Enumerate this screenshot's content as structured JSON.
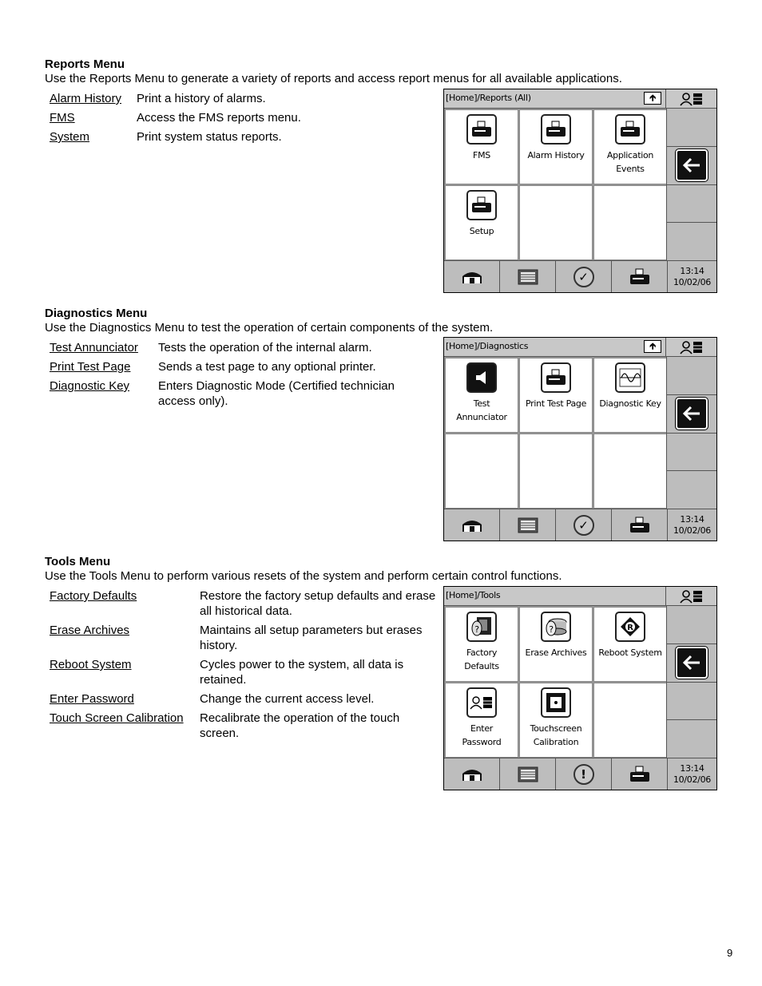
{
  "page_number": "9",
  "sections": [
    {
      "title": "Reports Menu",
      "intro": "Use the Reports Menu to generate a variety of reports and access report menus for all available applications.",
      "items": [
        {
          "term": "Alarm History",
          "desc": "Print a history of alarms."
        },
        {
          "term": "FMS",
          "desc": "Access the FMS reports menu."
        },
        {
          "term": "System",
          "desc": "Print system status reports."
        }
      ],
      "screen": {
        "breadcrumb": "[Home]/Reports (All)",
        "has_up_button": true,
        "tiles": [
          {
            "label": "FMS",
            "icon": "printer-icon"
          },
          {
            "label": "Alarm History",
            "icon": "printer-icon"
          },
          {
            "label": "Application Events",
            "icon": "printer-icon"
          },
          {
            "label": "Setup",
            "icon": "printer-icon"
          },
          {
            "label": "",
            "icon": ""
          },
          {
            "label": "",
            "icon": ""
          }
        ],
        "status_icon": "check-icon",
        "time": "13:14",
        "date": "10/02/06"
      }
    },
    {
      "title": "Diagnostics Menu",
      "intro": "Use the Diagnostics Menu to test the operation of certain components of the system.",
      "items": [
        {
          "term": "Test Annunciator",
          "desc": "Tests the operation of the internal alarm."
        },
        {
          "term": "Print Test Page",
          "desc": "Sends a test page to any optional printer."
        },
        {
          "term": "Diagnostic Key",
          "desc": "Enters Diagnostic Mode (Certified technician access only)."
        }
      ],
      "screen": {
        "breadcrumb": "[Home]/Diagnostics",
        "has_up_button": true,
        "tiles": [
          {
            "label": "Test Annunciator",
            "icon": "speaker-icon"
          },
          {
            "label": "Print Test Page",
            "icon": "printer-icon"
          },
          {
            "label": "Diagnostic Key",
            "icon": "waveform-icon"
          },
          {
            "label": "",
            "icon": ""
          },
          {
            "label": "",
            "icon": ""
          },
          {
            "label": "",
            "icon": ""
          }
        ],
        "status_icon": "check-icon",
        "time": "13:14",
        "date": "10/02/06"
      }
    },
    {
      "title": "Tools Menu",
      "intro": "Use the Tools Menu to perform various resets of the system and perform certain control functions.",
      "items": [
        {
          "term": "Factory Defaults",
          "desc": "Restore the factory setup defaults and erase all historical data."
        },
        {
          "term": "Erase Archives",
          "desc": "Maintains all setup parameters but erases history."
        },
        {
          "term": "Reboot System",
          "desc": "Cycles power to the system, all data is retained."
        },
        {
          "term": "Enter Password",
          "desc": "Change the current access level."
        },
        {
          "term": "Touch Screen Calibration",
          "desc": "Recalibrate the operation of the touch screen."
        }
      ],
      "screen": {
        "breadcrumb": "[Home]/Tools",
        "has_up_button": false,
        "tiles": [
          {
            "label": "Factory Defaults",
            "icon": "factory-defaults-icon"
          },
          {
            "label": "Erase Archives",
            "icon": "erase-archives-icon"
          },
          {
            "label": "Reboot System",
            "icon": "reboot-icon"
          },
          {
            "label": "Enter Password",
            "icon": "password-icon"
          },
          {
            "label": "Touchscreen Calibration",
            "icon": "calibration-icon"
          },
          {
            "label": "",
            "icon": ""
          }
        ],
        "status_icon": "alert-icon",
        "time": "13:14",
        "date": "10/02/06"
      }
    }
  ]
}
